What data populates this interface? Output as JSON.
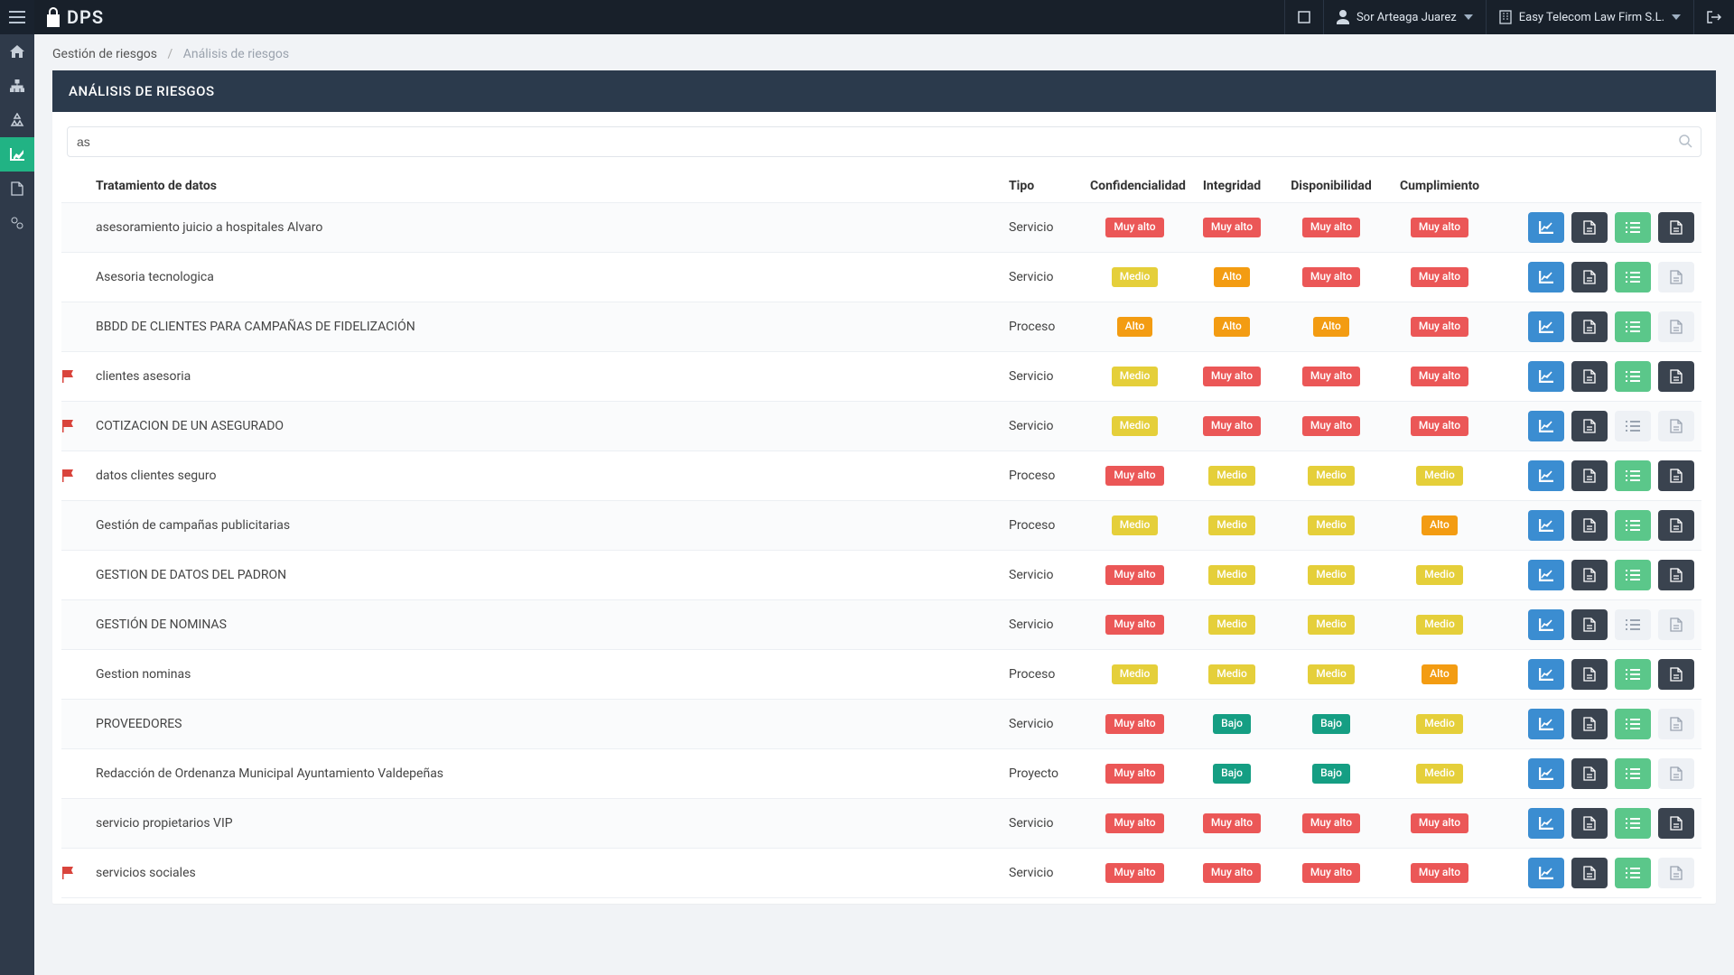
{
  "brand": "DPS",
  "user_name": "Sor Arteaga Juarez",
  "org_name": "Easy Telecom Law Firm S.L.",
  "breadcrumbs": {
    "root": "Gestión de riesgos",
    "current": "Análisis de riesgos"
  },
  "panel_title": "ANÁLISIS DE RIESGOS",
  "search_value": "as",
  "columns": {
    "name": "Tratamiento de datos",
    "type": "Tipo",
    "conf": "Confidencialidad",
    "integ": "Integridad",
    "disp": "Disponibilidad",
    "cumpl": "Cumplimiento"
  },
  "levels": {
    "muyalto": "Muy alto",
    "alto": "Alto",
    "medio": "Medio",
    "bajo": "Bajo"
  },
  "rows": [
    {
      "flag": false,
      "name": "asesoramiento juicio a hospitales Alvaro",
      "type": "Servicio",
      "conf": "muyalto",
      "integ": "muyalto",
      "disp": "muyalto",
      "cumpl": "muyalto",
      "btn3": "green",
      "btn4": "dark"
    },
    {
      "flag": false,
      "name": "Asesoria tecnologica",
      "type": "Servicio",
      "conf": "medio",
      "integ": "alto",
      "disp": "muyalto",
      "cumpl": "muyalto",
      "btn3": "green",
      "btn4": "light"
    },
    {
      "flag": false,
      "name": "BBDD DE CLIENTES PARA CAMPAÑAS DE FIDELIZACIÓN",
      "type": "Proceso",
      "conf": "alto",
      "integ": "alto",
      "disp": "alto",
      "cumpl": "muyalto",
      "btn3": "green",
      "btn4": "light"
    },
    {
      "flag": true,
      "name": "clientes asesoria",
      "type": "Servicio",
      "conf": "medio",
      "integ": "muyalto",
      "disp": "muyalto",
      "cumpl": "muyalto",
      "btn3": "green",
      "btn4": "dark"
    },
    {
      "flag": true,
      "name": "COTIZACION DE UN ASEGURADO",
      "type": "Servicio",
      "conf": "medio",
      "integ": "muyalto",
      "disp": "muyalto",
      "cumpl": "muyalto",
      "btn3": "light",
      "btn4": "light"
    },
    {
      "flag": true,
      "name": "datos clientes seguro",
      "type": "Proceso",
      "conf": "muyalto",
      "integ": "medio",
      "disp": "medio",
      "cumpl": "medio",
      "btn3": "green",
      "btn4": "dark"
    },
    {
      "flag": false,
      "name": "Gestión de campañas publicitarias",
      "type": "Proceso",
      "conf": "medio",
      "integ": "medio",
      "disp": "medio",
      "cumpl": "alto",
      "btn3": "green",
      "btn4": "dark"
    },
    {
      "flag": false,
      "name": "GESTION DE DATOS DEL PADRON",
      "type": "Servicio",
      "conf": "muyalto",
      "integ": "medio",
      "disp": "medio",
      "cumpl": "medio",
      "btn3": "green",
      "btn4": "dark"
    },
    {
      "flag": false,
      "name": "GESTIÓN DE NOMINAS",
      "type": "Servicio",
      "conf": "muyalto",
      "integ": "medio",
      "disp": "medio",
      "cumpl": "medio",
      "btn3": "light",
      "btn4": "light"
    },
    {
      "flag": false,
      "name": "Gestion nominas",
      "type": "Proceso",
      "conf": "medio",
      "integ": "medio",
      "disp": "medio",
      "cumpl": "alto",
      "btn3": "green",
      "btn4": "dark"
    },
    {
      "flag": false,
      "name": "PROVEEDORES",
      "type": "Servicio",
      "conf": "muyalto",
      "integ": "bajo",
      "disp": "bajo",
      "cumpl": "medio",
      "btn3": "green",
      "btn4": "light"
    },
    {
      "flag": false,
      "name": "Redacción de Ordenanza Municipal Ayuntamiento Valdepeñas",
      "type": "Proyecto",
      "conf": "muyalto",
      "integ": "bajo",
      "disp": "bajo",
      "cumpl": "medio",
      "btn3": "green",
      "btn4": "light"
    },
    {
      "flag": false,
      "name": "servicio propietarios VIP",
      "type": "Servicio",
      "conf": "muyalto",
      "integ": "muyalto",
      "disp": "muyalto",
      "cumpl": "muyalto",
      "btn3": "green",
      "btn4": "dark"
    },
    {
      "flag": true,
      "name": "servicios sociales",
      "type": "Servicio",
      "conf": "muyalto",
      "integ": "muyalto",
      "disp": "muyalto",
      "cumpl": "muyalto",
      "btn3": "green",
      "btn4": "light"
    }
  ]
}
